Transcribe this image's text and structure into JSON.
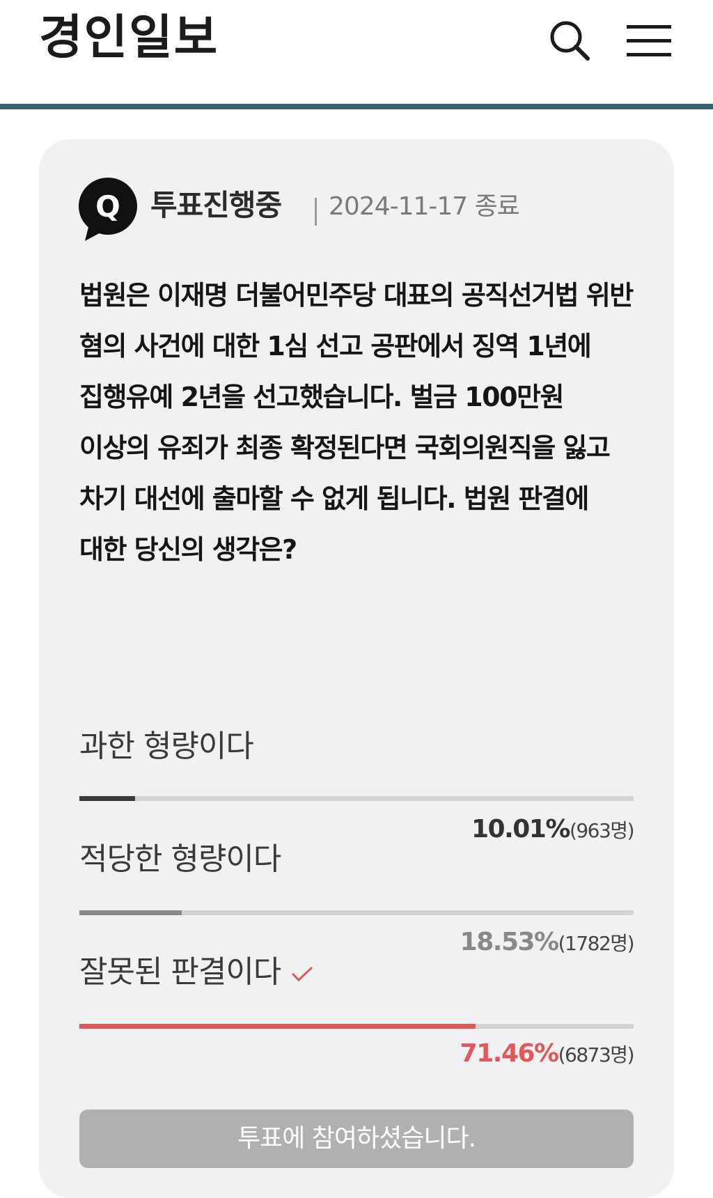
{
  "header": {
    "logo_text": "경인일보",
    "search_icon": "search-icon",
    "menu_icon": "hamburger-menu-icon",
    "rule_color": "#36606f"
  },
  "poll": {
    "badge_letter": "Q",
    "status": "투표진행중",
    "end_date": "2024-11-17 종료",
    "question": "법원은 이재명 더불어민주당 대표의 공직선거법 위반 혐의 사건에 대한 1심 선고 공판에서 징역 1년에 집행유예 2년을 선고했습니다. 벌금 100만원 이상의 유죄가 최종 확정된다면 국회의원직을 잃고 차기 대선에 출마할 수 없게 됩니다. 법원 판결에 대한 당신의 생각은?",
    "options": [
      {
        "label": "과한 형량이다",
        "percent": 10.01,
        "percent_text": "10.01%",
        "count_text": "(963명)",
        "bar_color": "#3a3a3a",
        "text_color": "#333333",
        "selected": false
      },
      {
        "label": "적당한 형량이다",
        "percent": 18.53,
        "percent_text": "18.53%",
        "count_text": "(1782명)",
        "bar_color": "#888888",
        "text_color": "#888888",
        "selected": false
      },
      {
        "label": "잘못된 판결이다",
        "percent": 71.46,
        "percent_text": "71.46%",
        "count_text": "(6873명)",
        "bar_color": "#e05858",
        "text_color": "#e05858",
        "selected": true,
        "selected_icon": "check-icon"
      }
    ],
    "vote_button_label": "투표에 참여하셨습니다."
  }
}
